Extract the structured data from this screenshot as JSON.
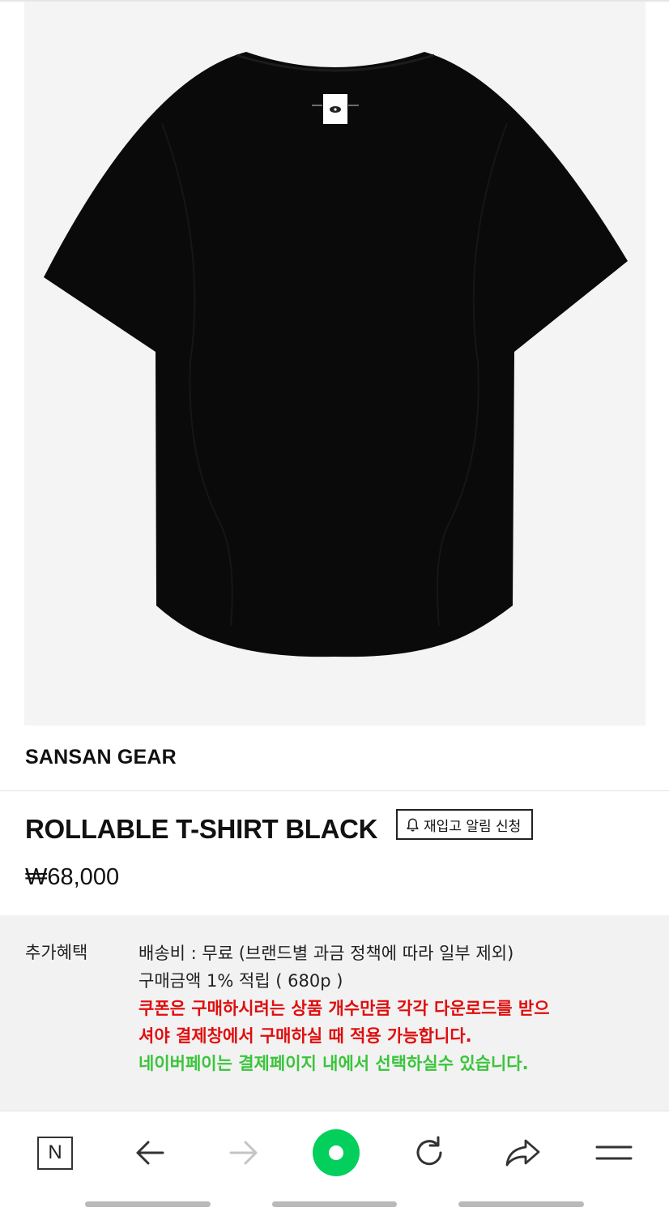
{
  "product": {
    "brand": "SANSAN GEAR",
    "title": "ROLLABLE T-SHIRT BLACK",
    "restock_label": "재입고 알림 신청",
    "price": "₩68,000",
    "image_alt": "ROLLABLE T-SHIRT BLACK"
  },
  "benefits": {
    "label": "추가혜택",
    "shipping": "배송비 : 무료 (브랜드별 과금 정책에 따라 일부 제외)",
    "points": "구매금액 1% 적립 ( 680p )",
    "coupon_notice_1": "쿠폰은 구매하시려는 상품 개수만큼 각각 다운로드를 받으",
    "coupon_notice_2": "셔야 결제창에서 구매하실 때 적용 가능합니다.",
    "naverpay_notice": "네이버페이는 결제페이지 내에서 선택하실수 있습니다."
  },
  "colors": {
    "coupon_notice": "#e00d0d",
    "naverpay_notice": "#3bc43b",
    "home_button": "#03cf5d",
    "benefit_background": "#f2f2f2"
  },
  "bottom_nav": {
    "naver_label": "N",
    "icons": [
      "naver-logo-icon",
      "arrow-left-icon",
      "arrow-right-icon",
      "home-circle-icon",
      "refresh-icon",
      "share-icon",
      "menu-icon"
    ]
  }
}
